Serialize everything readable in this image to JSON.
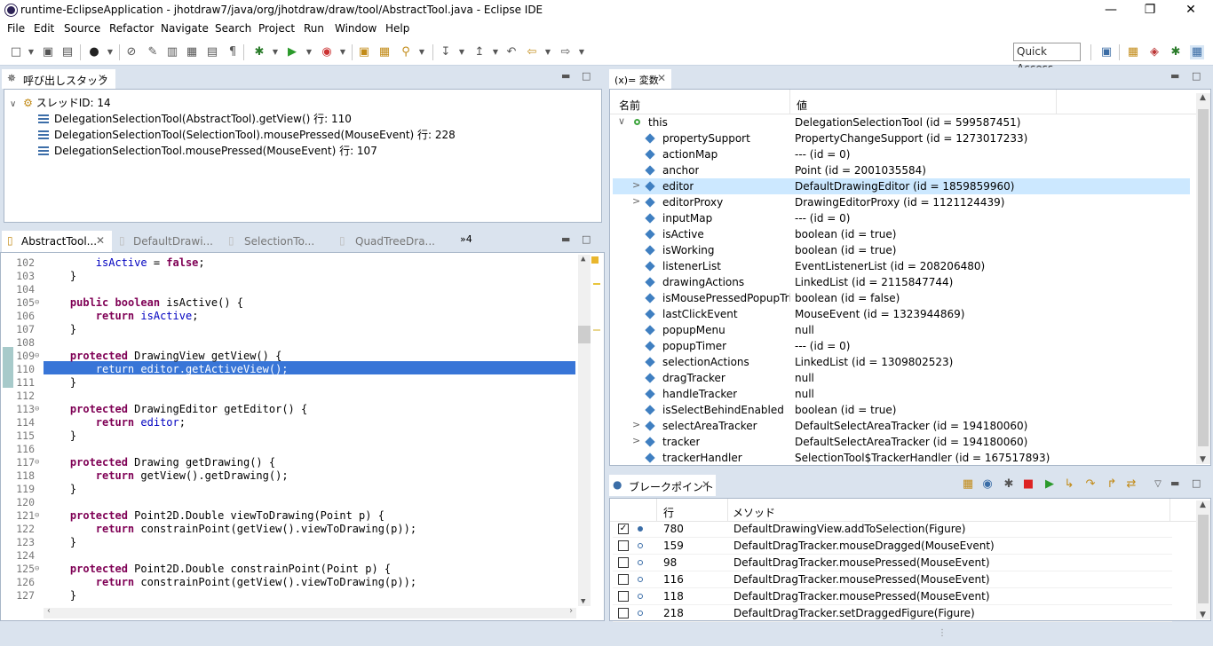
{
  "window": {
    "title": "runtime-EclipseApplication - jhotdraw7/java/org/jhotdraw/draw/tool/AbstractTool.java - Eclipse IDE"
  },
  "menu": [
    "File",
    "Edit",
    "Source",
    "Refactor",
    "Navigate",
    "Search",
    "Project",
    "Run",
    "Window",
    "Help"
  ],
  "quick_access": "Quick Access",
  "callstack": {
    "tab_label": "呼び出しスタック",
    "thread": "スレッドID: 14",
    "frames": [
      "DelegationSelectionTool(AbstractTool).getView() 行: 110",
      "DelegationSelectionTool(SelectionTool).mousePressed(MouseEvent) 行: 228",
      "DelegationSelectionTool.mousePressed(MouseEvent) 行: 107"
    ]
  },
  "editor": {
    "tabs": [
      "AbstractTool...",
      "DefaultDrawi...",
      "SelectionTo...",
      "QuadTreeDra..."
    ],
    "overflow": "»4",
    "lines": [
      {
        "n": "102",
        "fold": "",
        "t": "        isActive = false;"
      },
      {
        "n": "103",
        "fold": "",
        "t": "    }"
      },
      {
        "n": "104",
        "fold": "",
        "t": ""
      },
      {
        "n": "105",
        "fold": "⊖",
        "t": "    public boolean isActive() {"
      },
      {
        "n": "106",
        "fold": "",
        "t": "        return isActive;"
      },
      {
        "n": "107",
        "fold": "",
        "t": "    }"
      },
      {
        "n": "108",
        "fold": "",
        "t": ""
      },
      {
        "n": "109",
        "fold": "⊖",
        "t": "    protected DrawingView getView() {"
      },
      {
        "n": "110",
        "fold": "",
        "t": "        return editor.getActiveView();"
      },
      {
        "n": "111",
        "fold": "",
        "t": "    }"
      },
      {
        "n": "112",
        "fold": "",
        "t": ""
      },
      {
        "n": "113",
        "fold": "⊖",
        "t": "    protected DrawingEditor getEditor() {"
      },
      {
        "n": "114",
        "fold": "",
        "t": "        return editor;"
      },
      {
        "n": "115",
        "fold": "",
        "t": "    }"
      },
      {
        "n": "116",
        "fold": "",
        "t": ""
      },
      {
        "n": "117",
        "fold": "⊖",
        "t": "    protected Drawing getDrawing() {"
      },
      {
        "n": "118",
        "fold": "",
        "t": "        return getView().getDrawing();"
      },
      {
        "n": "119",
        "fold": "",
        "t": "    }"
      },
      {
        "n": "120",
        "fold": "",
        "t": ""
      },
      {
        "n": "121",
        "fold": "⊖",
        "t": "    protected Point2D.Double viewToDrawing(Point p) {"
      },
      {
        "n": "122",
        "fold": "",
        "t": "        return constrainPoint(getView().viewToDrawing(p));"
      },
      {
        "n": "123",
        "fold": "",
        "t": "    }"
      },
      {
        "n": "124",
        "fold": "",
        "t": ""
      },
      {
        "n": "125",
        "fold": "⊖",
        "t": "    protected Point2D.Double constrainPoint(Point p) {"
      },
      {
        "n": "126",
        "fold": "",
        "t": "        return constrainPoint(getView().viewToDrawing(p));"
      },
      {
        "n": "127",
        "fold": "",
        "t": "    }"
      }
    ]
  },
  "variables": {
    "tab_label": "(x)= 変数",
    "col_name": "名前",
    "col_value": "値",
    "rows": [
      {
        "name": "this",
        "value": "DelegationSelectionTool (id = 599587451)",
        "exp": "∨"
      },
      {
        "name": "propertySupport",
        "value": "PropertyChangeSupport (id = 1273017233)",
        "exp": ""
      },
      {
        "name": "actionMap",
        "value": "--- (id = 0)",
        "exp": ""
      },
      {
        "name": "anchor",
        "value": "Point (id = 2001035584)",
        "exp": ""
      },
      {
        "name": "editor",
        "value": "DefaultDrawingEditor (id = 1859859960)",
        "exp": ">"
      },
      {
        "name": "editorProxy",
        "value": "DrawingEditorProxy (id = 1121124439)",
        "exp": ">"
      },
      {
        "name": "inputMap",
        "value": "--- (id = 0)",
        "exp": ""
      },
      {
        "name": "isActive",
        "value": "boolean (id = true)",
        "exp": ""
      },
      {
        "name": "isWorking",
        "value": "boolean (id = true)",
        "exp": ""
      },
      {
        "name": "listenerList",
        "value": "EventListenerList (id = 208206480)",
        "exp": ""
      },
      {
        "name": "drawingActions",
        "value": "LinkedList (id = 2115847744)",
        "exp": ""
      },
      {
        "name": "isMousePressedPopupTrigg",
        "value": "boolean (id = false)",
        "exp": ""
      },
      {
        "name": "lastClickEvent",
        "value": "MouseEvent (id = 1323944869)",
        "exp": ""
      },
      {
        "name": "popupMenu",
        "value": "null",
        "exp": ""
      },
      {
        "name": "popupTimer",
        "value": "--- (id = 0)",
        "exp": ""
      },
      {
        "name": "selectionActions",
        "value": "LinkedList (id = 1309802523)",
        "exp": ""
      },
      {
        "name": "dragTracker",
        "value": "null",
        "exp": ""
      },
      {
        "name": "handleTracker",
        "value": "null",
        "exp": ""
      },
      {
        "name": "isSelectBehindEnabled",
        "value": "boolean (id = true)",
        "exp": ""
      },
      {
        "name": "selectAreaTracker",
        "value": "DefaultSelectAreaTracker (id = 194180060)",
        "exp": ">"
      },
      {
        "name": "tracker",
        "value": "DefaultSelectAreaTracker (id = 194180060)",
        "exp": ">"
      },
      {
        "name": "trackerHandler",
        "value": "SelectionTool$TrackerHandler (id = 167517893)",
        "exp": ""
      }
    ]
  },
  "breakpoints": {
    "tab_label": "ブレークポイント",
    "col_line": "行",
    "col_method": "メソッド",
    "rows": [
      {
        "checked": "✓",
        "line": "780",
        "method": "DefaultDrawingView.addToSelection(Figure)"
      },
      {
        "checked": "",
        "line": "159",
        "method": "DefaultDragTracker.mouseDragged(MouseEvent)"
      },
      {
        "checked": "",
        "line": "98",
        "method": "DefaultDragTracker.mousePressed(MouseEvent)"
      },
      {
        "checked": "",
        "line": "116",
        "method": "DefaultDragTracker.mousePressed(MouseEvent)"
      },
      {
        "checked": "",
        "line": "118",
        "method": "DefaultDragTracker.mousePressed(MouseEvent)"
      },
      {
        "checked": "",
        "line": "218",
        "method": "DefaultDragTracker.setDraggedFigure(Figure)"
      }
    ]
  },
  "colors": {
    "selection": "#3875d7",
    "row_highlight": "#cce8ff",
    "keyword": "#7f0055",
    "field": "#0000c0"
  }
}
